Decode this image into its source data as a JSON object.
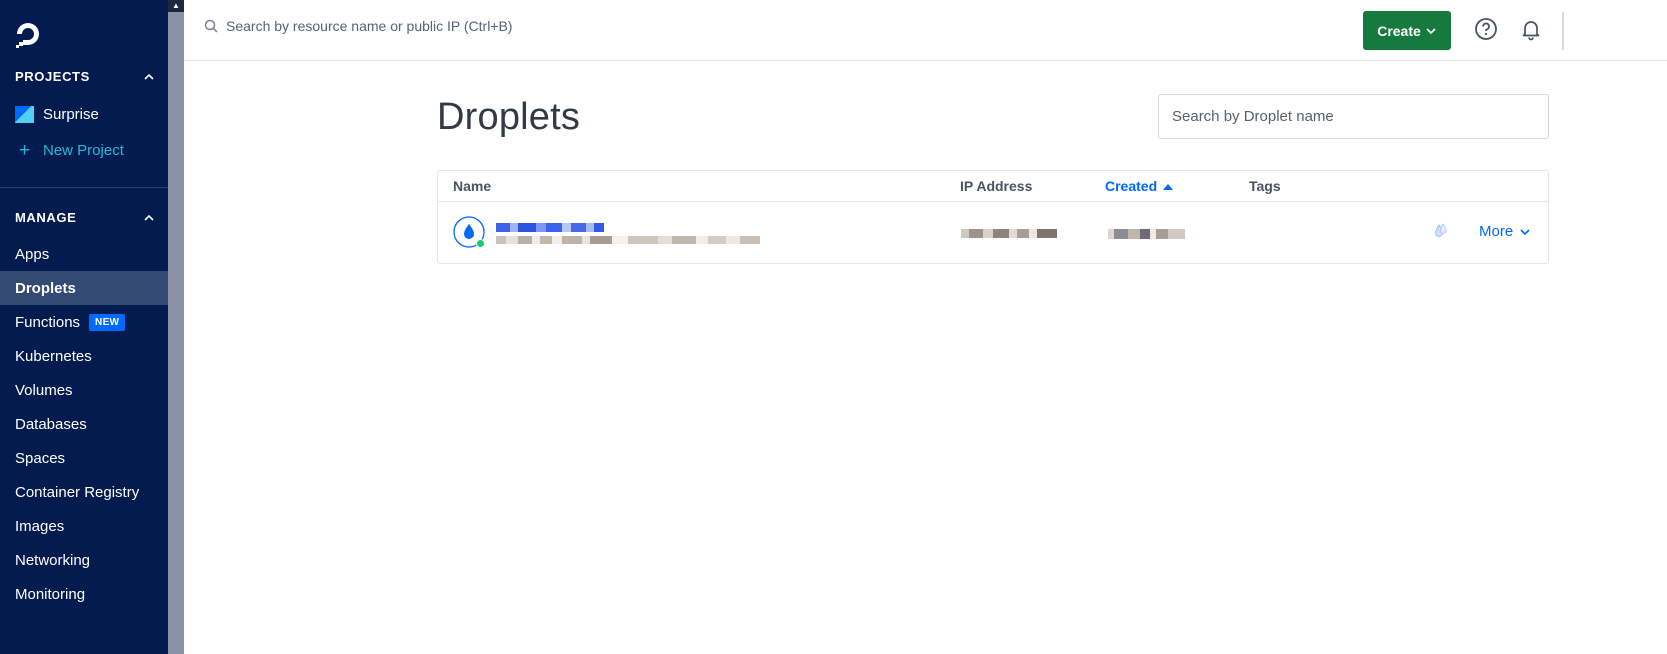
{
  "sidebar": {
    "projects_heading": "PROJECTS",
    "projects": [
      {
        "label": "Surprise"
      }
    ],
    "new_project_label": "New Project",
    "manage_heading": "MANAGE",
    "nav": [
      {
        "label": "Apps",
        "active": false
      },
      {
        "label": "Droplets",
        "active": true
      },
      {
        "label": "Functions",
        "active": false,
        "badge": "NEW"
      },
      {
        "label": "Kubernetes",
        "active": false
      },
      {
        "label": "Volumes",
        "active": false
      },
      {
        "label": "Databases",
        "active": false
      },
      {
        "label": "Spaces",
        "active": false
      },
      {
        "label": "Container Registry",
        "active": false
      },
      {
        "label": "Images",
        "active": false
      },
      {
        "label": "Networking",
        "active": false
      },
      {
        "label": "Monitoring",
        "active": false
      }
    ]
  },
  "topbar": {
    "search_placeholder": "Search by resource name or public IP (Ctrl+B)",
    "create_label": "Create"
  },
  "main": {
    "title": "Droplets",
    "search_placeholder": "Search by Droplet name",
    "table": {
      "columns": [
        "Name",
        "IP Address",
        "Created",
        "Tags"
      ],
      "sorted_column": "Created",
      "sort_direction": "ascending",
      "rows": [
        {
          "status": "running",
          "more_label": "More"
        }
      ]
    }
  },
  "colors": {
    "sidebar_bg": "#031b4e",
    "accent_blue": "#0069ff",
    "create_green": "#167a3f",
    "status_green": "#15cd72"
  }
}
